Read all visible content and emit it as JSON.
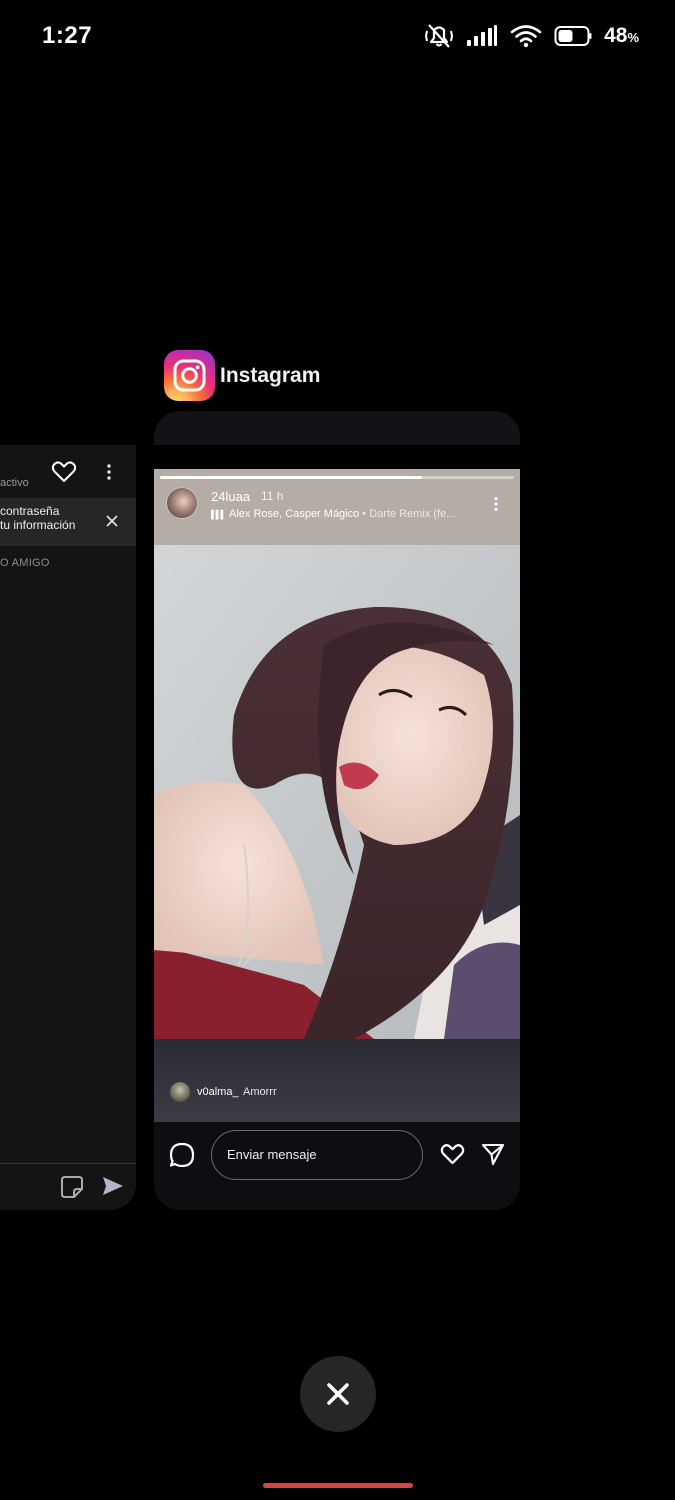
{
  "status_bar": {
    "time": "1:27",
    "battery_percent": "48",
    "battery_unit": "%",
    "icons": [
      "mute-vibrate-icon",
      "signal-icon",
      "wifi-icon",
      "battery-icon"
    ]
  },
  "left_card": {
    "active_text": "activo",
    "banner_line1": "contraseña",
    "banner_line2": "tu información",
    "section_label": "O AMIGO",
    "icons": [
      "heart-icon",
      "more-vertical-icon",
      "close-icon",
      "sticker-icon",
      "send-icon"
    ]
  },
  "app": {
    "name": "Instagram",
    "icon": "instagram-icon"
  },
  "story": {
    "progress": 0.74,
    "username": "24luaa",
    "time_ago": "11 h",
    "music_artists": "Alex Rose, Casper Mágico",
    "music_song": " • Darte Remix (fe..."
  },
  "reply": {
    "user": "v0alma_",
    "text": "Amorrr"
  },
  "reply_bar": {
    "input_placeholder": "Enviar mensaje"
  },
  "colors": {
    "background": "#000000",
    "card": "#0e0d11",
    "gesture_bar": "#d8453f",
    "close_button": "#262626"
  }
}
